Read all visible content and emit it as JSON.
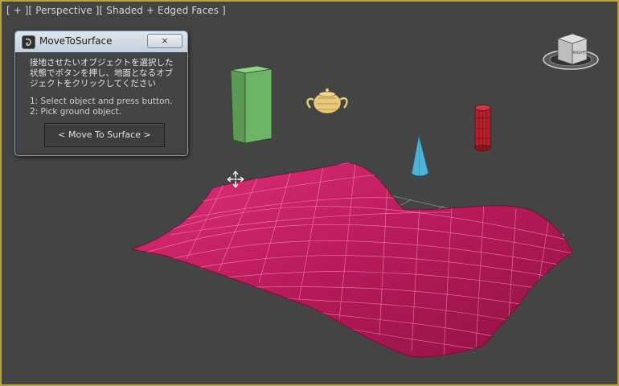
{
  "viewport": {
    "label": "[ + ][ Perspective ][ Shaded + Edged Faces ]",
    "border_color": "#b8a23a",
    "background_color": "#444444"
  },
  "viewcube": {
    "face_label": "RIGHT",
    "icon": "viewcube-icon"
  },
  "scene": {
    "objects": [
      {
        "name": "box",
        "color": "#6aa862"
      },
      {
        "name": "teapot",
        "color": "#e8c87a"
      },
      {
        "name": "cylinder",
        "color": "#b81f2a"
      },
      {
        "name": "cone",
        "color": "#4fb4d8"
      },
      {
        "name": "terrain",
        "color": "#c41e62"
      },
      {
        "name": "grid",
        "color": "#888888"
      }
    ]
  },
  "dialog": {
    "title": "MoveToSurface",
    "close_symbol": "⨯",
    "instructions_jp": "接地させたいオブジェクトを選択した状態でボタンを押し、地面となるオブジェクトをクリックしてください",
    "step1": "1: Select object and press button.",
    "step2": "2: Pick ground object.",
    "button_label": "< Move To Surface >"
  }
}
